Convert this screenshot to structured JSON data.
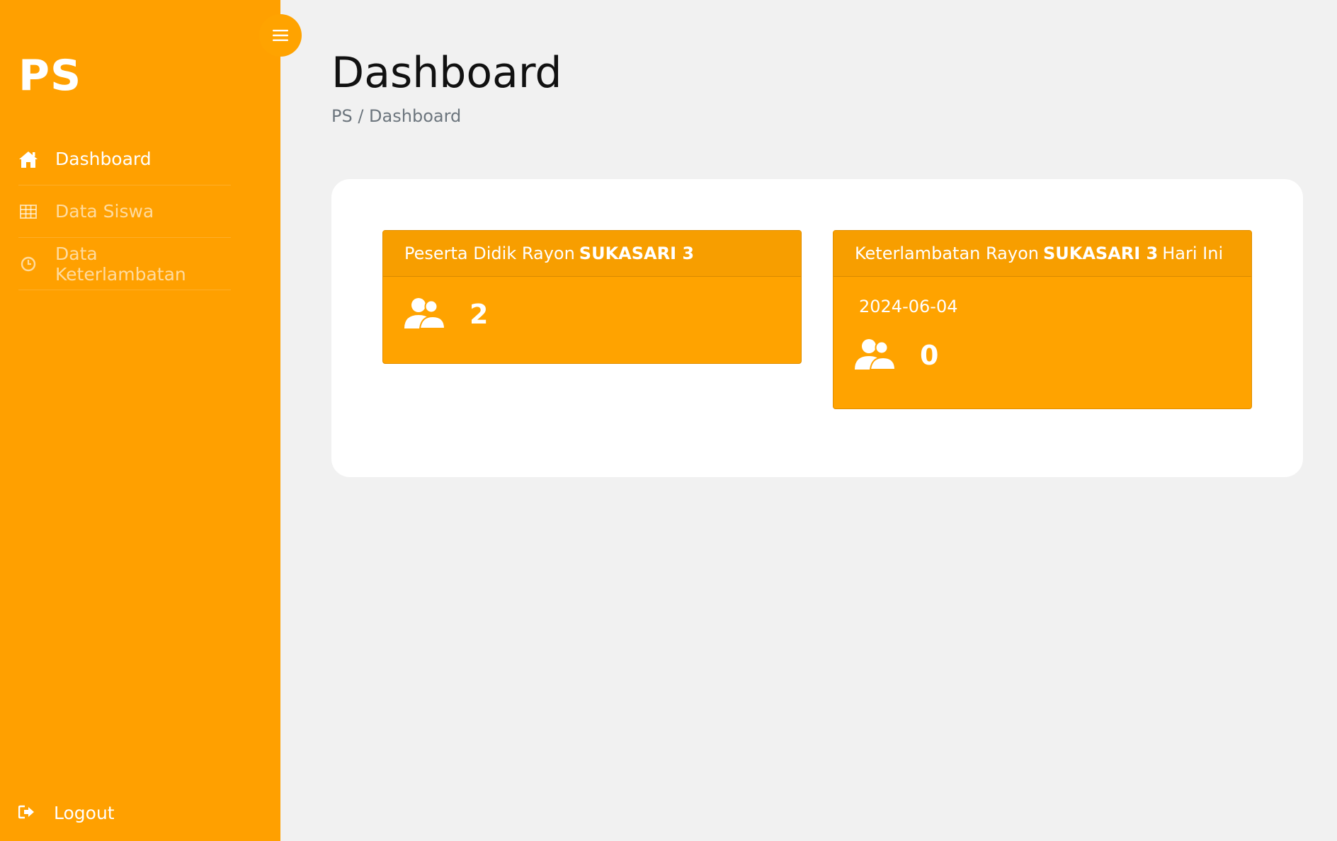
{
  "sidebar": {
    "brand": "PS",
    "items": [
      {
        "label": "Dashboard",
        "icon": "home-icon",
        "active": true
      },
      {
        "label": "Data Siswa",
        "icon": "table-icon",
        "active": false
      },
      {
        "label": "Data Keterlambatan",
        "icon": "clock-icon",
        "active": false
      }
    ],
    "logout_label": "Logout",
    "background": "#ffa000"
  },
  "header": {
    "title": "Dashboard",
    "breadcrumb": "PS / Dashboard"
  },
  "cards": [
    {
      "title_prefix": "Peserta Didik Rayon",
      "rayon": "SUKASARI 3",
      "title_suffix": "",
      "value": "2"
    },
    {
      "title_prefix": "Keterlambatan Rayon",
      "rayon": "SUKASARI 3",
      "title_suffix": "Hari Ini",
      "date": "2024-06-04",
      "value": "0"
    }
  ],
  "colors": {
    "accent": "#ffa000",
    "card": "#ffa300",
    "card_header": "#f79e00",
    "page_bg": "#f1f1f1"
  }
}
